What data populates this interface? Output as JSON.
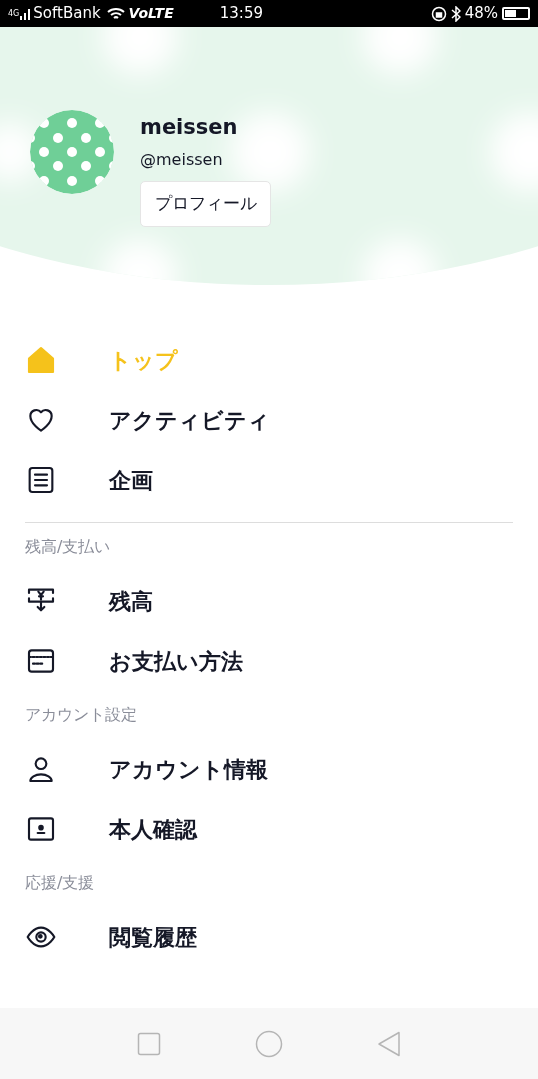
{
  "status_bar": {
    "network": "4G",
    "carrier": "SoftBank",
    "volte": "VoLTE",
    "time": "13:59",
    "battery": "48%"
  },
  "profile": {
    "name": "meissen",
    "handle": "@meissen",
    "button": "プロフィール"
  },
  "menu": [
    {
      "label": "トップ",
      "selected": true
    },
    {
      "label": "アクティビティ",
      "selected": false
    },
    {
      "label": "企画",
      "selected": false
    }
  ],
  "sections": [
    {
      "title": "残高/支払い",
      "items": [
        {
          "label": "残高",
          "selected": false
        },
        {
          "label": "お支払い方法",
          "selected": false
        }
      ]
    },
    {
      "title": "アカウント設定",
      "items": [
        {
          "label": "アカウント情報",
          "selected": false
        },
        {
          "label": "本人確認",
          "selected": false
        }
      ]
    },
    {
      "title": "応援/支援",
      "items": [
        {
          "label": "閲覧履歴",
          "selected": false
        }
      ]
    }
  ]
}
